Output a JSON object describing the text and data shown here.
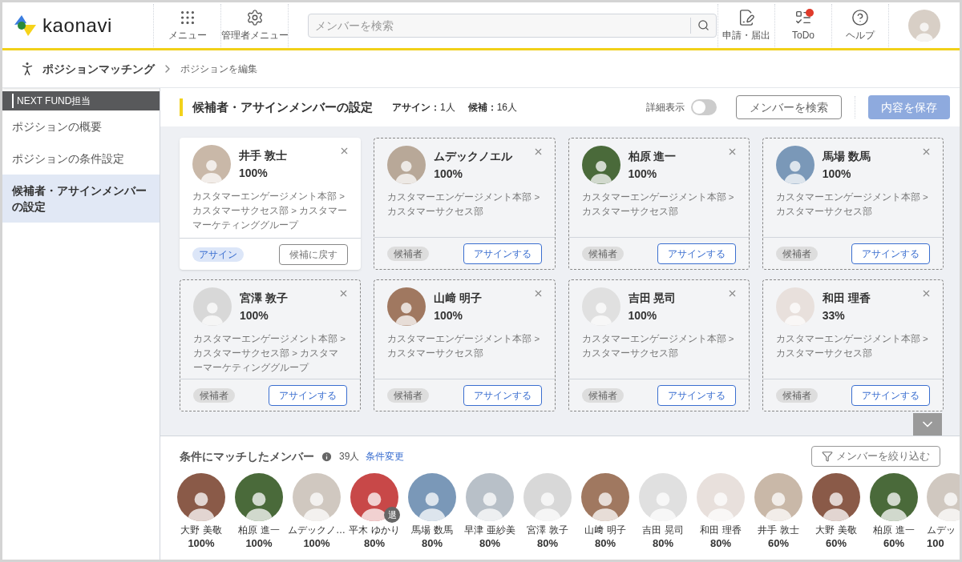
{
  "header": {
    "logo": "kaonavi",
    "nav": [
      {
        "kind": "grid",
        "label": "メニュー"
      },
      {
        "kind": "gear",
        "label": "管理者メニュー"
      }
    ],
    "search": {
      "placeholder": "メンバーを検索"
    },
    "right_nav": [
      {
        "kind": "form",
        "label": "申請・届出",
        "badge": false
      },
      {
        "kind": "todo",
        "label": "ToDo",
        "badge": true
      },
      {
        "kind": "help",
        "label": "ヘルプ",
        "badge": false
      }
    ]
  },
  "breadcrumb": {
    "title": "ポジションマッチング",
    "current": "ポジションを編集"
  },
  "sidebar": {
    "group": "NEXT FUND担当",
    "items": [
      {
        "label": "ポジションの概要",
        "selected": false
      },
      {
        "label": "ポジションの条件設定",
        "selected": false
      },
      {
        "label": "候補者・アサインメンバーの設定",
        "selected": true
      }
    ]
  },
  "section": {
    "title": "候補者・アサインメンバーの設定",
    "assign_label": "アサイン：",
    "assign_count": "1人",
    "candidate_label": "候補：",
    "candidate_count": "16人",
    "detail_label": "詳細表示",
    "detail_on": false,
    "search_button": "メンバーを検索",
    "save_button": "内容を保存",
    "save_disabled": true
  },
  "cards": [
    {
      "name": "井手 敦士",
      "score": "100%",
      "dept": "カスタマーエンゲージメント本部 > カスタマーサクセス部 > カスタマーマーケティンググループ",
      "assigned": true,
      "status": "アサイン",
      "action": "候補に戻す",
      "color": "#c9b8a8"
    },
    {
      "name": "ムデックノエル",
      "score": "100%",
      "dept": "カスタマーエンゲージメント本部 > カスタマーサクセス部",
      "assigned": false,
      "status": "候補者",
      "action": "アサインする",
      "color": "#b8a898"
    },
    {
      "name": "柏原 進一",
      "score": "100%",
      "dept": "カスタマーエンゲージメント本部 > カスタマーサクセス部",
      "assigned": false,
      "status": "候補者",
      "action": "アサインする",
      "color": "#4a6a3a"
    },
    {
      "name": "馬場 数馬",
      "score": "100%",
      "dept": "カスタマーエンゲージメント本部 > カスタマーサクセス部",
      "assigned": false,
      "status": "候補者",
      "action": "アサインする",
      "color": "#7a98b8"
    },
    {
      "name": "宮澤 敦子",
      "score": "100%",
      "dept": "カスタマーエンゲージメント本部 > カスタマーサクセス部 > カスタマーマーケティンググループ",
      "assigned": false,
      "status": "候補者",
      "action": "アサインする",
      "color": "#d8d8d8"
    },
    {
      "name": "山﨑 明子",
      "score": "100%",
      "dept": "カスタマーエンゲージメント本部 > カスタマーサクセス部",
      "assigned": false,
      "status": "候補者",
      "action": "アサインする",
      "color": "#a07860"
    },
    {
      "name": "吉田 晃司",
      "score": "100%",
      "dept": "カスタマーエンゲージメント本部 > カスタマーサクセス部",
      "assigned": false,
      "status": "候補者",
      "action": "アサインする",
      "color": "#e0e0e0"
    },
    {
      "name": "和田 理香",
      "score": "33%",
      "dept": "カスタマーエンゲージメント本部 > カスタマーサクセス部",
      "assigned": false,
      "status": "候補者",
      "action": "アサインする",
      "color": "#e8e0dc"
    }
  ],
  "matched": {
    "title": "条件にマッチしたメンバー",
    "count": "39人",
    "change_link": "条件変更",
    "filter_button": "メンバーを絞り込む",
    "retired_label": "退",
    "members": [
      {
        "name": "大野 美敬",
        "score": "100%",
        "retired": false,
        "color": "#8a5a48"
      },
      {
        "name": "柏原 進一",
        "score": "100%",
        "retired": false,
        "color": "#4a6a3a"
      },
      {
        "name": "ムデックノ…",
        "score": "100%",
        "retired": false,
        "color": "#d0c8c0"
      },
      {
        "name": "平木 ゆかり",
        "score": "80%",
        "retired": true,
        "color": "#c84848"
      },
      {
        "name": "馬場 数馬",
        "score": "80%",
        "retired": false,
        "color": "#7a98b8"
      },
      {
        "name": "早津 亜紗美",
        "score": "80%",
        "retired": false,
        "color": "#b8c0c8"
      },
      {
        "name": "宮澤 敦子",
        "score": "80%",
        "retired": false,
        "color": "#d8d8d8"
      },
      {
        "name": "山﨑 明子",
        "score": "80%",
        "retired": false,
        "color": "#a07860"
      },
      {
        "name": "吉田 晃司",
        "score": "80%",
        "retired": false,
        "color": "#e0e0e0"
      },
      {
        "name": "和田 理香",
        "score": "80%",
        "retired": false,
        "color": "#e8e0dc"
      },
      {
        "name": "井手 敦士",
        "score": "60%",
        "retired": false,
        "color": "#c9b8a8"
      },
      {
        "name": "大野 美敬",
        "score": "60%",
        "retired": false,
        "color": "#8a5a48"
      },
      {
        "name": "柏原 進一",
        "score": "60%",
        "retired": false,
        "color": "#4a6a3a"
      },
      {
        "name": "ムデッ",
        "score": "100",
        "retired": false,
        "partial": true,
        "color": "#d0c8c0"
      }
    ]
  }
}
